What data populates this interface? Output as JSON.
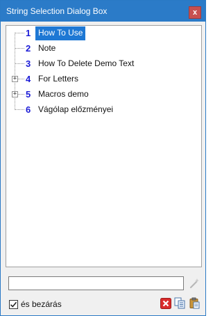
{
  "window": {
    "title": "String Selection Dialog Box",
    "close_label": "x",
    "accent_color": "#2b7bc8"
  },
  "tree": {
    "items": [
      {
        "number": "1",
        "label": "How To Use",
        "selected": true,
        "expandable": false
      },
      {
        "number": "2",
        "label": "Note",
        "selected": false,
        "expandable": false
      },
      {
        "number": "3",
        "label": "How To Delete Demo Text",
        "selected": false,
        "expandable": false
      },
      {
        "number": "4",
        "label": "For Letters",
        "selected": false,
        "expandable": true
      },
      {
        "number": "5",
        "label": "Macros demo",
        "selected": false,
        "expandable": true
      },
      {
        "number": "6",
        "label": "Vágólap előzményei",
        "selected": false,
        "expandable": false
      }
    ]
  },
  "bottom": {
    "filter_value": "",
    "close_after_label": "és bezárás",
    "close_after_checked": true,
    "icons": [
      "magic-wand-icon",
      "delete-icon",
      "copy-icon",
      "paste-icon"
    ]
  }
}
